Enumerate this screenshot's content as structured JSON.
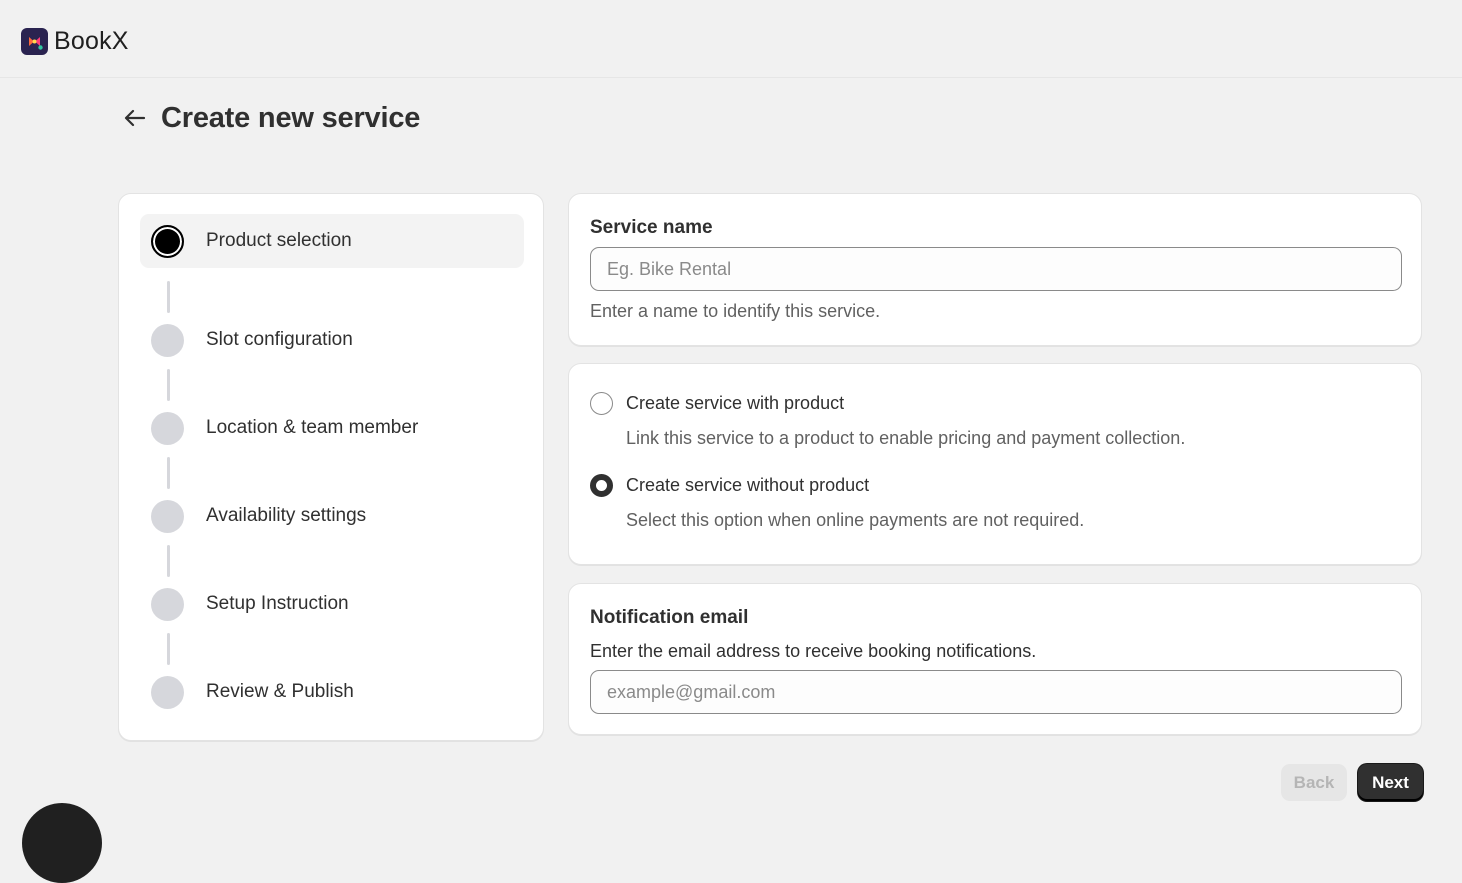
{
  "app": {
    "name": "BookX"
  },
  "page": {
    "title": "Create new service"
  },
  "steps": [
    {
      "label": "Product selection",
      "active": true
    },
    {
      "label": "Slot configuration",
      "active": false
    },
    {
      "label": "Location & team member",
      "active": false
    },
    {
      "label": "Availability settings",
      "active": false
    },
    {
      "label": "Setup Instruction",
      "active": false
    },
    {
      "label": "Review & Publish",
      "active": false
    }
  ],
  "service_name": {
    "title": "Service name",
    "placeholder": "Eg. Bike Rental",
    "value": "",
    "help": "Enter a name to identify this service."
  },
  "product_options": [
    {
      "label": "Create service with product",
      "help": "Link this service to a product to enable pricing and payment collection.",
      "checked": false
    },
    {
      "label": "Create service without product",
      "help": "Select this option when online payments are not required.",
      "checked": true
    }
  ],
  "notification_email": {
    "title": "Notification email",
    "help": "Enter the email address to receive booking notifications.",
    "placeholder": "example@gmail.com",
    "value": ""
  },
  "actions": {
    "back_label": "Back",
    "next_label": "Next"
  },
  "icons": {
    "back": "arrow-left-icon",
    "logo": "bookx-logo-icon"
  },
  "colors": {
    "primary": "#303030",
    "step_inactive": "#d6d7dc",
    "background": "#f1f1f1"
  }
}
